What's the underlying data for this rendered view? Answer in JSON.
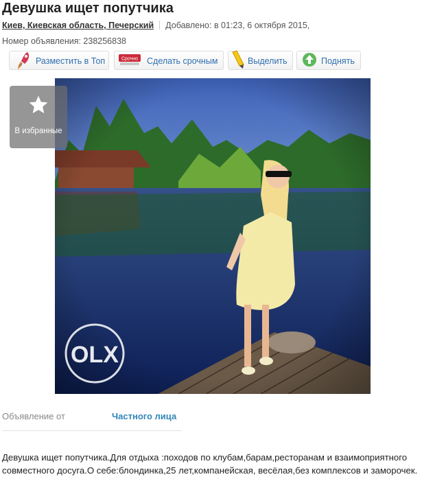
{
  "ad": {
    "title": "Девушка ищет попутчика",
    "location": "Киев, Киевская область, Печерский",
    "added": "Добавлено: в 01:23, 6 октября 2015,",
    "ad_number": "Номер объявления: 238256838"
  },
  "actions": [
    {
      "label": "Разместить в Топ",
      "icon": "rocket-icon"
    },
    {
      "label": "Сделать срочным",
      "icon": "urgent-tag-icon",
      "badge": "Срочно"
    },
    {
      "label": "Выделить",
      "icon": "highlighter-icon"
    },
    {
      "label": "Поднять",
      "icon": "raise-arrow-icon"
    }
  ],
  "gallery": {
    "favorite_label": "В избранные",
    "watermark": "OLX"
  },
  "seller": {
    "label": "Объявление от",
    "value": "Частного лица"
  },
  "description": "Девушка ищет попутчика.Для отдыха :походов по клубам,барам,ресторанам и взаимоприятного совместного досуга.О себе:блондинка,25 лет,компанейская, весёлая,без комплексов и заморочек."
}
